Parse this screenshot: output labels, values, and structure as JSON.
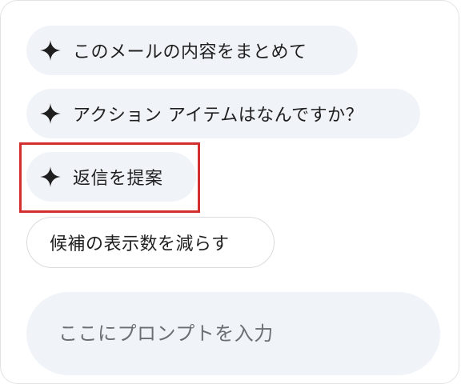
{
  "suggestions": [
    {
      "label": "このメールの内容をまとめて",
      "icon": "sparkle-icon"
    },
    {
      "label": "アクション アイテムはなんですか？",
      "icon": "sparkle-icon"
    },
    {
      "label": "返信を提案",
      "icon": "sparkle-icon"
    }
  ],
  "fewer_suggestions_label": "候補の表示数を減らす",
  "prompt": {
    "placeholder": "ここにプロンプトを入力",
    "value": ""
  },
  "colors": {
    "chip_bg": "#f0f4f9",
    "highlight": "#d32f2f",
    "text": "#1f1f1f"
  }
}
